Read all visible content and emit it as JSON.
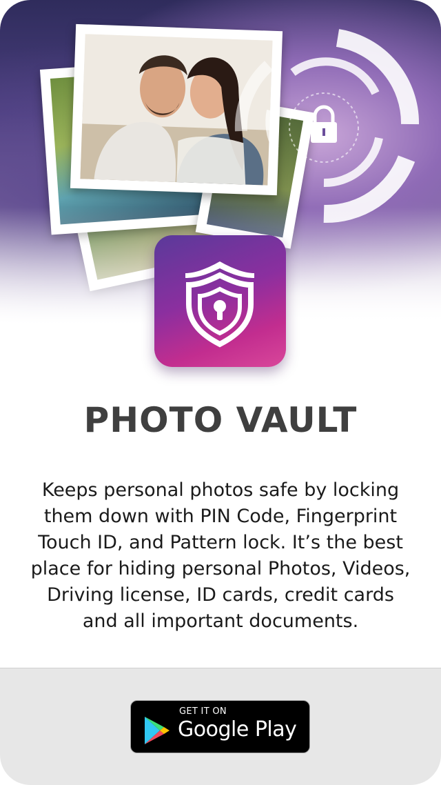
{
  "app": {
    "title": "PHOTO VAULT",
    "description": "Keeps personal photos safe by locking them down with PIN Code, Fingerprint Touch ID, and Pattern lock. It’s the best place for hiding personal Photos, Videos, Driving license, ID cards, credit cards and all important documents."
  },
  "store_badge": {
    "small_text": "GET IT ON",
    "big_text": "Google Play"
  },
  "icons": {
    "app_icon": "shield-keyhole-icon",
    "lock": "padlock-icon",
    "store": "google-play-icon"
  },
  "colors": {
    "title": "#3f3f3f",
    "text": "#1a1a1a",
    "footer_bg": "#e7e7e7",
    "icon_gradient_start": "#5a3a9a",
    "icon_gradient_end": "#d9479a",
    "badge_bg": "#000000"
  }
}
